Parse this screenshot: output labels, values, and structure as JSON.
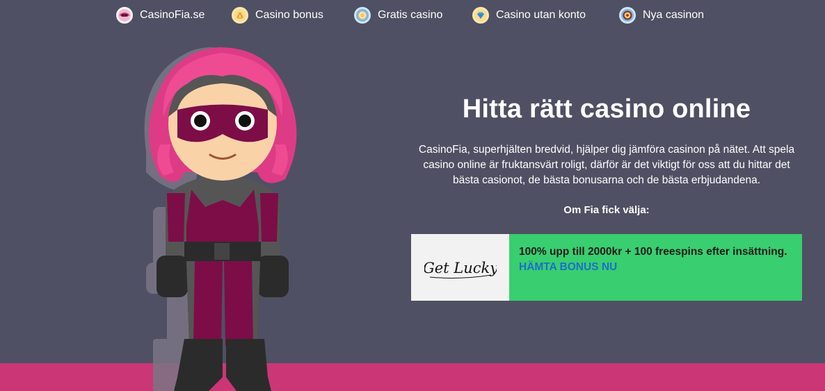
{
  "nav": {
    "items": [
      {
        "label": "CasinoFia.se",
        "icon": "fia-mask-icon",
        "color": "#f3b8cf"
      },
      {
        "label": "Casino bonus",
        "icon": "money-bag-icon",
        "color": "#f5c86a"
      },
      {
        "label": "Gratis casino",
        "icon": "clock-coin-icon",
        "color": "#7bb6e8"
      },
      {
        "label": "Casino utan konto",
        "icon": "diamond-icon",
        "color": "#f5c86a"
      },
      {
        "label": "Nya casinon",
        "icon": "roulette-icon",
        "color": "#7bb6e8"
      }
    ]
  },
  "hero": {
    "title": "Hitta rätt casino online",
    "intro": "CasinoFia, superhjälten bredvid, hjälper dig jämföra casinon på nätet. Att spela casino online är fruktansvärt roligt, därför är det viktigt för oss att du hittar det bästa casionot, de bästa bonusarna och de bästa erbjudandena.",
    "pick_label": "Om Fia fick välja:"
  },
  "offer": {
    "logo_text": "Get Lucky",
    "description": "100% upp till 2000kr + 100 freespins efter insättning.",
    "cta": "HÄMTA BONUS NU"
  },
  "colors": {
    "background": "#4f5063",
    "accent_pink": "#cb3776",
    "offer_green": "#39ce6f",
    "cta_blue": "#1b6fc9"
  }
}
